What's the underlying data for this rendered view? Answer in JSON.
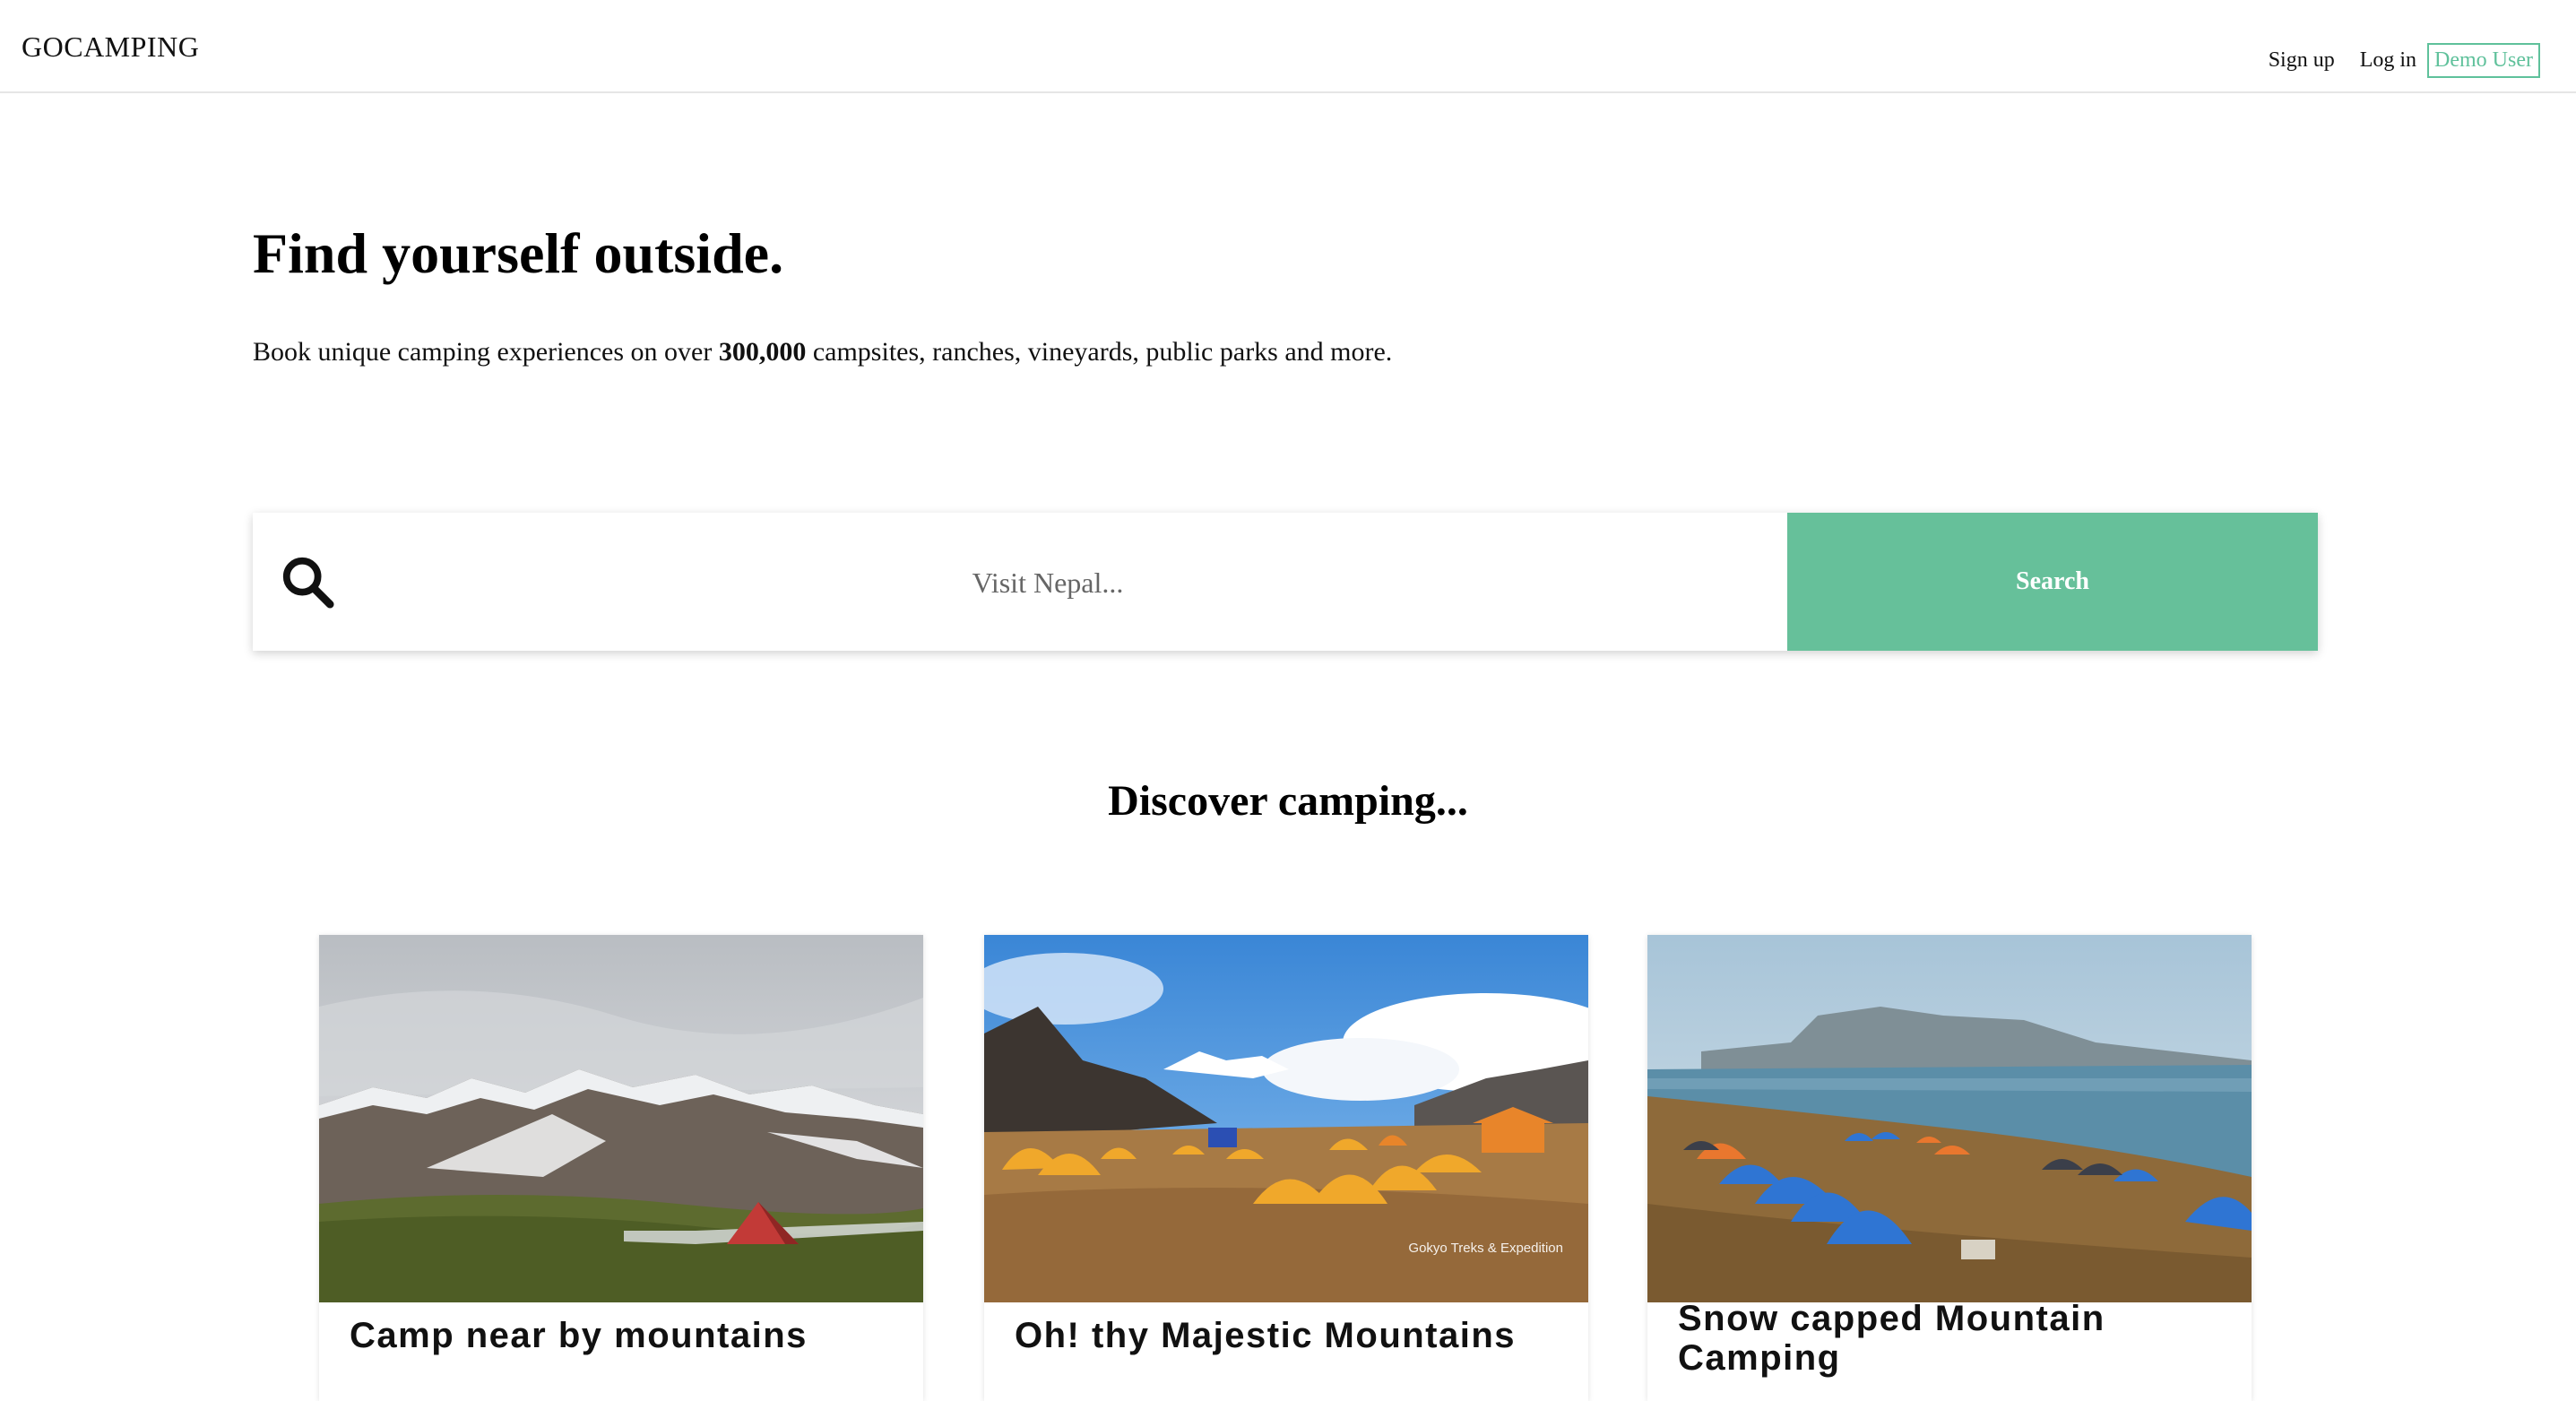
{
  "navbar": {
    "logo": "GOCAMPING",
    "signup_label": "Sign up",
    "login_label": "Log in",
    "demo_label": "Demo User"
  },
  "hero": {
    "title": "Find yourself outside.",
    "subtitle_before": "Book unique camping experiences on over ",
    "subtitle_count": "300,000",
    "subtitle_after": " campsites, ranches, vineyards, public parks and more."
  },
  "search": {
    "placeholder": "Visit Nepal...",
    "value": "",
    "button_label": "Search",
    "icon": "search-icon"
  },
  "discover": {
    "title": "Discover camping..."
  },
  "cards": [
    {
      "title": "Camp near by mountains",
      "image": "snowy-mountains-red-tent"
    },
    {
      "title": "Oh! thy Majestic Mountains",
      "image": "yellow-tents-mountain-camp",
      "watermark": "Gokyo Treks & Expedition"
    },
    {
      "title": "Snow capped Mountain Camping",
      "image": "blue-tents-lakeside"
    }
  ],
  "colors": {
    "accent": "#66c09a",
    "demo_border": "#5fc19b"
  }
}
